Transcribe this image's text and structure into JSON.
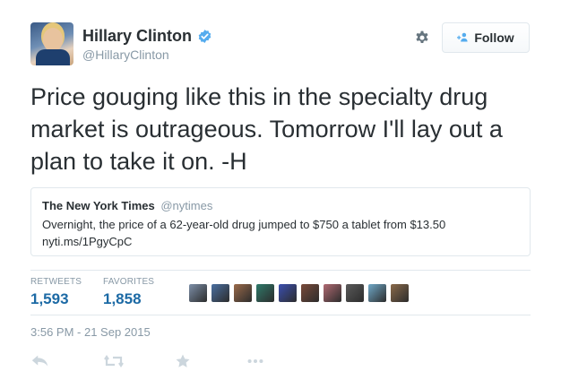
{
  "author": {
    "name": "Hillary Clinton",
    "handle": "@HillaryClinton",
    "verified_icon": "verified-badge-icon",
    "avatar": "profile-photo"
  },
  "actions_top": {
    "gear_icon": "gear-icon",
    "follow_label": "Follow",
    "follow_icon": "add-user-icon"
  },
  "tweet": {
    "text": "Price gouging like this in the specialty drug market is outrageous. Tomorrow I'll lay out a plan to take it on. -H"
  },
  "quoted": {
    "name": "The New York Times",
    "handle": "@nytimes",
    "text": "Overnight, the price of a 62-year-old drug jumped to $750 a tablet from $13.50",
    "link": "nyti.ms/1PgyCpC"
  },
  "stats": {
    "retweets_label": "RETWEETS",
    "retweets_value": "1,593",
    "favorites_label": "FAVORITES",
    "favorites_value": "1,858"
  },
  "favoriters": [
    {
      "name": "favoriter-avatar",
      "color": "#7d8fa8"
    },
    {
      "name": "favoriter-avatar",
      "color": "#4a6fa0"
    },
    {
      "name": "favoriter-avatar",
      "color": "#9a6a4a"
    },
    {
      "name": "favoriter-avatar",
      "color": "#2f7a6a"
    },
    {
      "name": "favoriter-avatar",
      "color": "#3b4fb0"
    },
    {
      "name": "favoriter-avatar",
      "color": "#7a4a3a"
    },
    {
      "name": "favoriter-avatar",
      "color": "#b06a72"
    },
    {
      "name": "favoriter-avatar",
      "color": "#5a5a5a"
    },
    {
      "name": "favoriter-avatar",
      "color": "#6fa8c8"
    },
    {
      "name": "favoriter-avatar",
      "color": "#8a6a4a"
    }
  ],
  "timestamp": "3:56 PM - 21 Sep 2015",
  "actions_bottom": {
    "reply_icon": "reply-icon",
    "retweet_icon": "retweet-icon",
    "favorite_icon": "star-icon",
    "more_icon": "more-icon"
  },
  "colors": {
    "link_blue": "#1c6aa5",
    "verified_blue": "#55acee",
    "muted": "#8899a6",
    "border": "#e1e8ed",
    "action_gray": "#ccd6dd"
  }
}
